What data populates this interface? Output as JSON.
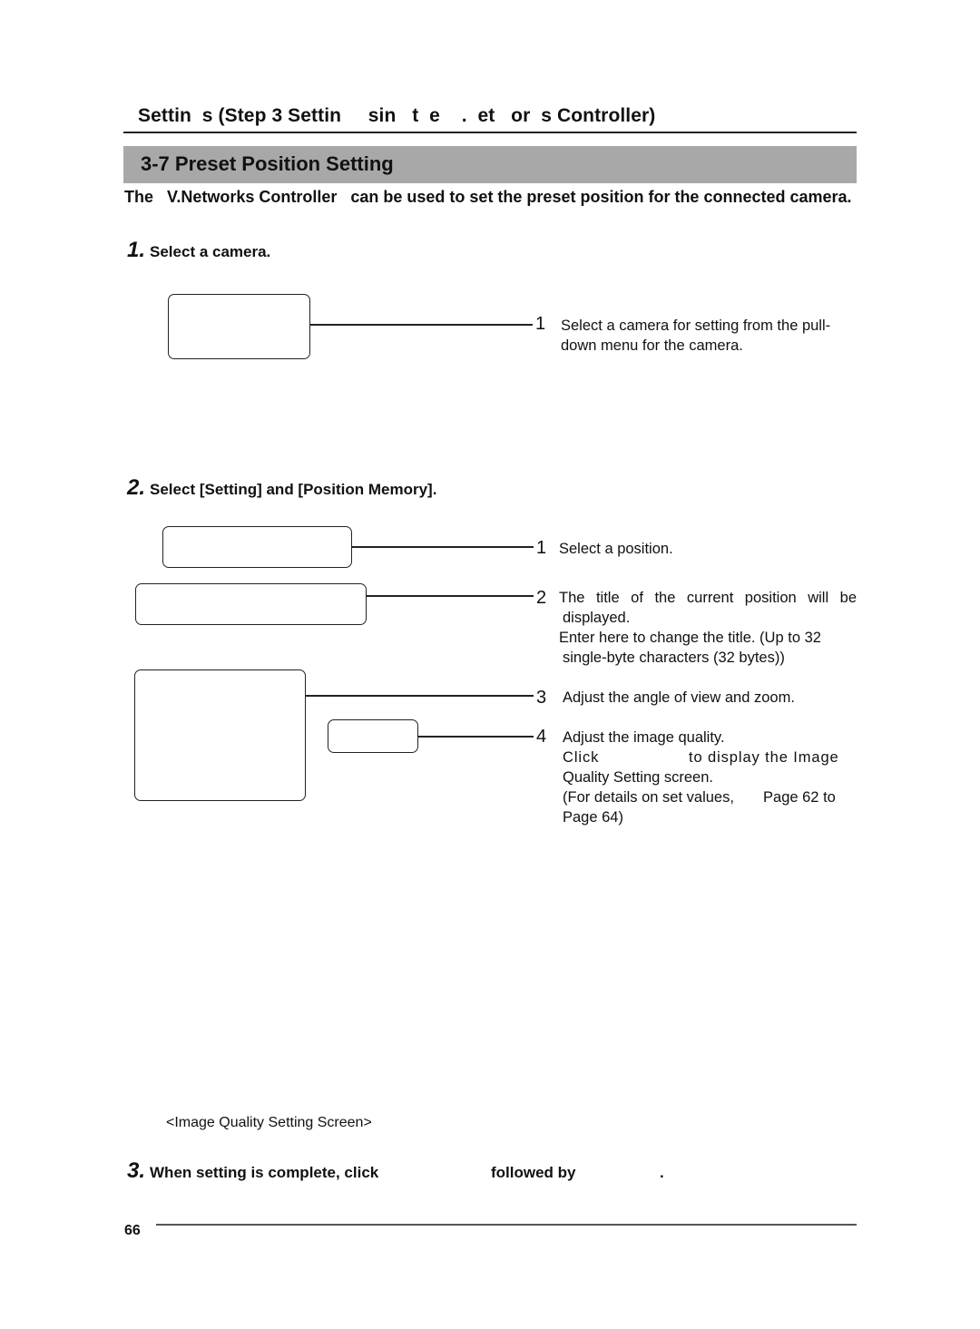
{
  "header": {
    "running_title": "Settin  s (Step 3 Settin     sin   t  e    .  et   or  s Controller)"
  },
  "section": {
    "number_title": "3-7 Preset Position Setting"
  },
  "intro": {
    "text": "The   V.Networks Controller   can be used to set the preset position for the connected camera."
  },
  "steps": [
    {
      "number": "1.",
      "label": "Select a camera.",
      "callouts": [
        {
          "num": "1",
          "lines": [
            "Select a camera for setting from the pull-",
            "down menu for the camera."
          ]
        }
      ]
    },
    {
      "number": "2.",
      "label": "Select [Setting] and [Position Memory].",
      "callouts": [
        {
          "num": "1",
          "lines": [
            "Select a position."
          ]
        },
        {
          "num": "2",
          "lines": [
            "The title of the current position will be",
            "displayed.",
            "Enter here to change the title. (Up to 32",
            "single-byte characters (32 bytes))"
          ]
        },
        {
          "num": "3",
          "lines": [
            "Adjust the angle of view and zoom."
          ]
        },
        {
          "num": "4",
          "lines": [
            "Adjust the image quality.",
            "Click                  to display the Image",
            "Quality Setting screen.",
            "(For details on set values,       Page 62 to",
            "Page 64)"
          ]
        }
      ]
    },
    {
      "number": "3.",
      "label_part1": "When setting is complete, click",
      "label_part2": "followed by",
      "label_part3": "."
    }
  ],
  "caption": "<Image Quality Setting Screen>",
  "footer": {
    "page_number": "66"
  }
}
